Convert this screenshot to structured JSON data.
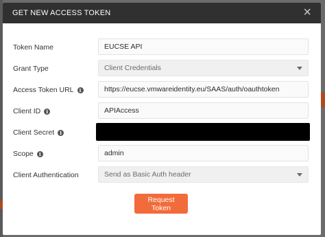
{
  "modal": {
    "title": "GET NEW ACCESS TOKEN",
    "close_symbol": "×"
  },
  "form": {
    "token_name": {
      "label": "Token Name",
      "value": "EUCSE API"
    },
    "grant_type": {
      "label": "Grant Type",
      "value": "Client Credentials"
    },
    "access_token_url": {
      "label": "Access Token URL",
      "value": "https://eucse.vmwareidentity.eu/SAAS/auth/oauthtoken"
    },
    "client_id": {
      "label": "Client ID",
      "value": "APIAccess"
    },
    "client_secret": {
      "label": "Client Secret",
      "value": ""
    },
    "scope": {
      "label": "Scope",
      "value": "admin"
    },
    "client_authentication": {
      "label": "Client Authentication",
      "value": "Send as Basic Auth header"
    }
  },
  "info_icon_glyph": "i",
  "request_button_label": "Request Token",
  "colors": {
    "header_bg": "#303030",
    "accent": "#f26b3a",
    "secret_redaction": "#000000"
  }
}
